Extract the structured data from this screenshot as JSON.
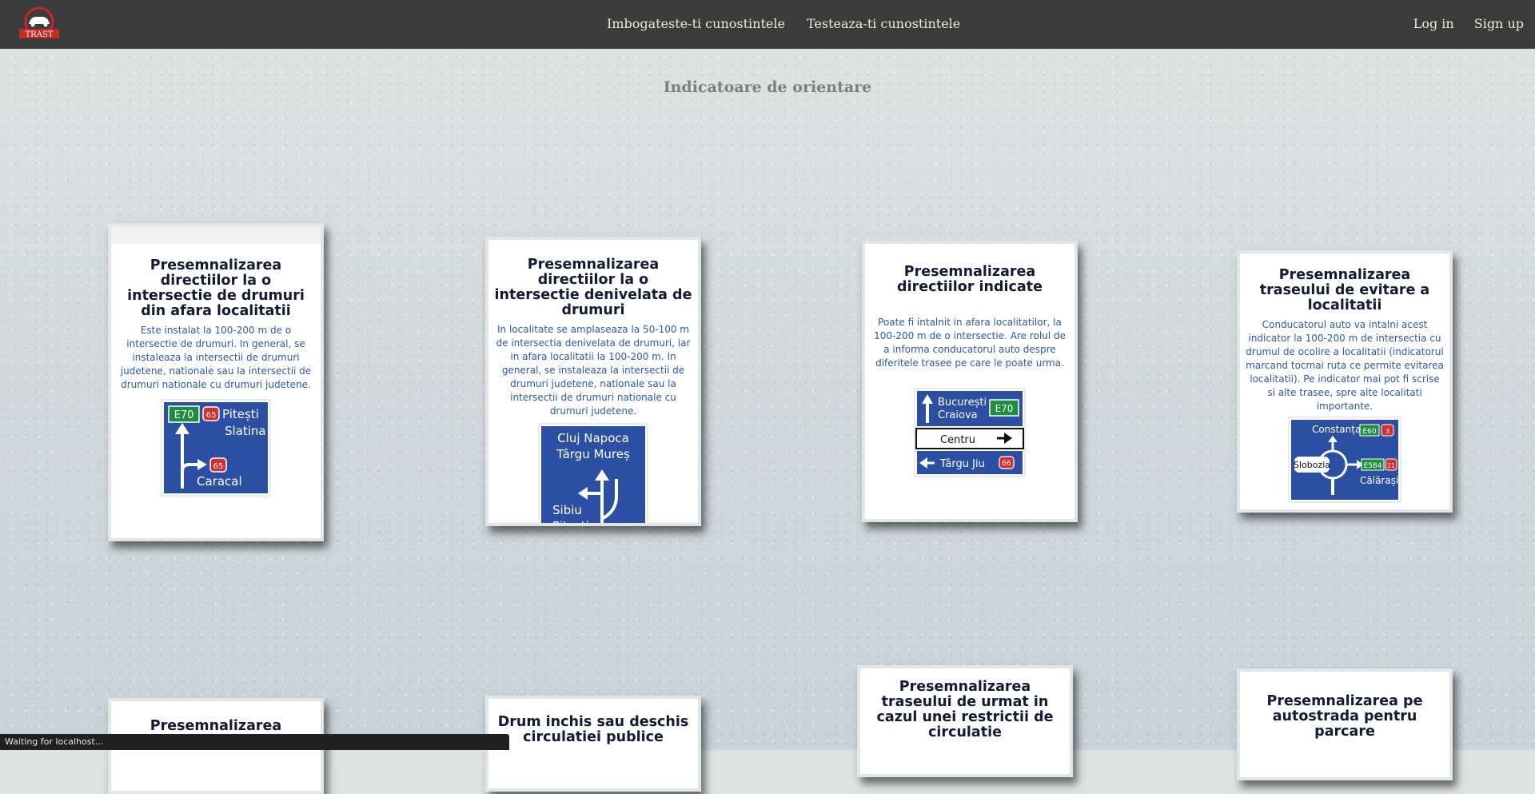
{
  "nav": {
    "logo_text": "TRAST",
    "center_links": [
      "Imbogateste-ti cunostintele",
      "Testeaza-ti cunostintele"
    ],
    "right_links": [
      "Log in",
      "Sign up"
    ]
  },
  "page": {
    "title": "Indicatoare de orientare"
  },
  "cards": [
    {
      "title": "Presemnalizarea directiilor la o intersectie de drumuri din afara localitatii",
      "text": "Este instalat la 100-200 m de o intersectie de drumuri. In general, se instaleaza la intersectii de drumuri judetene, nationale sau la intersectii de drumuri nationale cu drumuri judetene.",
      "sign": {
        "route_e": "E70",
        "route_dn": "65",
        "ahead": "Pitești",
        "ahead2": "Slatina",
        "right_dn": "65",
        "right": "Caracal"
      }
    },
    {
      "title": "Presemnalizarea directiilor la o intersectie denivelata de drumuri",
      "text": "In localitate se amplaseaza la 50-100 m de intersectia denivelata de drumuri, iar in afara localitatii la 100-200 m. In general, se instaleaza la intersectii de drumuri judetene, nationale sau la intersectii de drumuri nationale cu drumuri judetene.",
      "sign": {
        "top1": "Cluj Napoca",
        "top2": "Târgu Mureș",
        "left1": "Sibiu",
        "left2": "Pitești"
      }
    },
    {
      "title": "Presemnalizarea directiilor indicate",
      "text": "Poate fi intalnit in afara localitatilor, la 100-200 m de o intersectie. Are rolul de a informa conducatorul auto despre diferitele trasee pe care le poate urma.",
      "sign": {
        "ahead1": "București",
        "ahead2": "Craiova",
        "route_e": "E70",
        "mid": "Centru",
        "left": "Târgu Jiu",
        "left_dn": "66"
      }
    },
    {
      "title": "Presemnalizarea traseului de evitare a localitatii",
      "text": "Conducatorul auto va intalni acest indicator la 100-200 m de intersectia cu drumul de ocolire a localitatii (indicatorul marcand tocmai ruta ce permite evitarea localitatii). Pe indicator mai pot fi scrise si alte trasee, spre alte localitati importante.",
      "sign": {
        "top": "Constanța",
        "top_e": "E60",
        "top_dn": "3",
        "center": "Slobozia",
        "right": "Călărași",
        "right_e": "E584",
        "right_dn": "21"
      }
    }
  ],
  "cards_row2": [
    {
      "title": "Presemnalizarea directiilor intr-o"
    },
    {
      "title": "Drum inchis sau deschis circulatiei publice"
    },
    {
      "title": "Presemnalizarea traseului de urmat in cazul unei restrictii de circulatie"
    },
    {
      "title": "Presemnalizarea pe autostrada pentru parcare"
    }
  ],
  "status": {
    "text": "Waiting for localhost..."
  },
  "colors": {
    "navbar": "#3b3b3b",
    "nav_link": "#f3ead3",
    "sign_blue": "#2b4fa3",
    "description": "#2c58a4"
  }
}
